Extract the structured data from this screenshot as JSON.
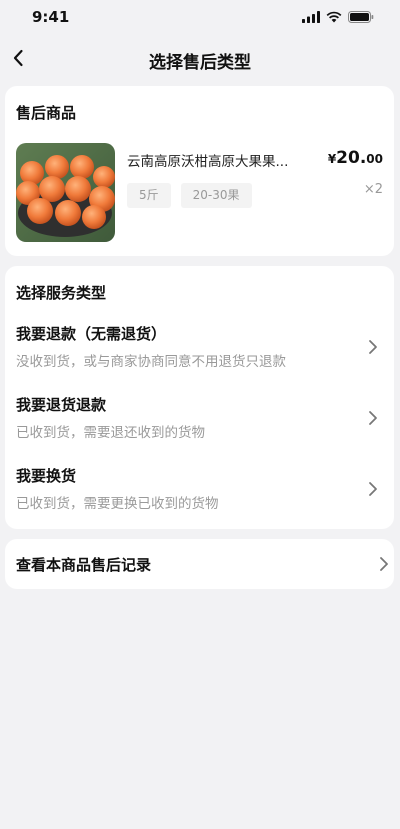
{
  "status_bar": {
    "time": "9:41"
  },
  "nav": {
    "title": "选择售后类型"
  },
  "product_section": {
    "title": "售后商品",
    "product": {
      "name": "云南高原沃柑高原大果果...",
      "spec_tags": [
        "5斤",
        "20-30果"
      ],
      "price_symbol": "¥",
      "price_int": "20.",
      "price_dec": "00",
      "quantity": "×2"
    }
  },
  "service_section": {
    "title": "选择服务类型",
    "items": [
      {
        "title": "我要退款（无需退货）",
        "desc": "没收到货，或与商家协商同意不用退货只退款"
      },
      {
        "title": "我要退货退款",
        "desc": "已收到货，需要退还收到的货物"
      },
      {
        "title": "我要换货",
        "desc": "已收到货，需要更换已收到的货物"
      }
    ]
  },
  "record_section": {
    "title": "查看本商品售后记录"
  },
  "colors": {
    "background": "#f2f2f4",
    "card": "#ffffff",
    "text": "#111111",
    "secondary": "#9a9a9a"
  }
}
